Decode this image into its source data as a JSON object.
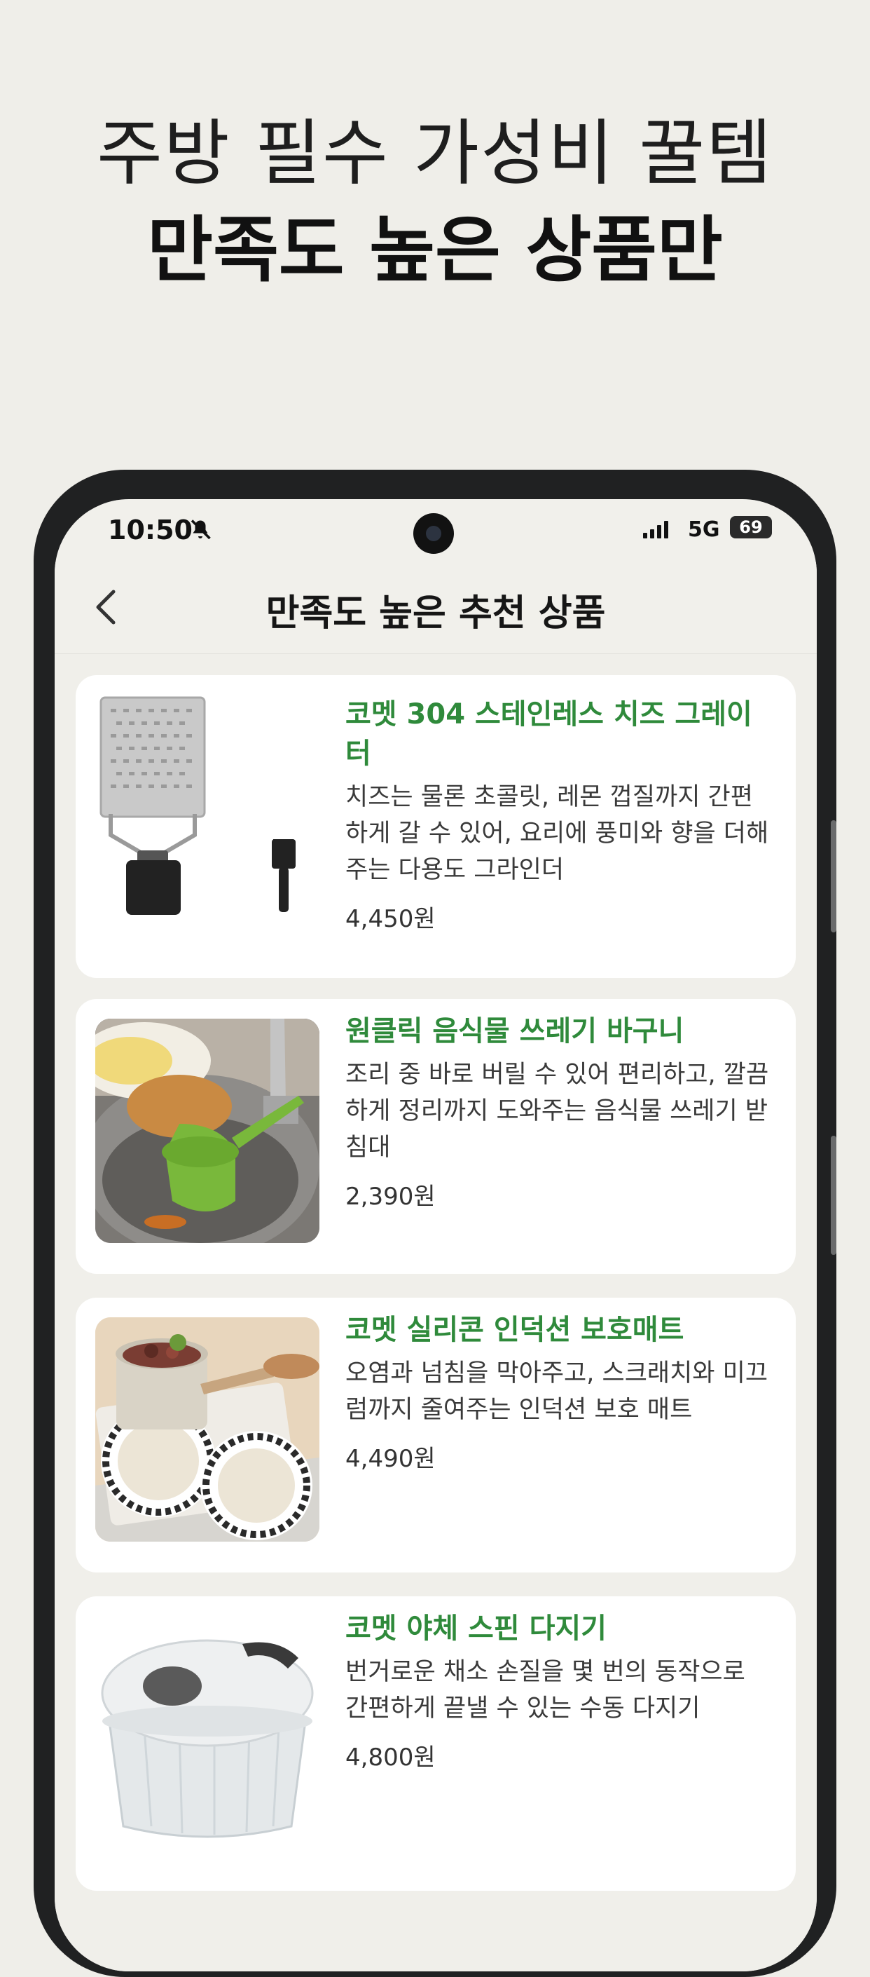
{
  "headline": {
    "line1": "주방 필수 가성비 꿀템",
    "line2": "만족도 높은 상품만"
  },
  "status_bar": {
    "time": "10:50",
    "network": "5G",
    "battery": "69"
  },
  "nav": {
    "title": "만족도 높은 추천 상품"
  },
  "products": [
    {
      "title": "코멧 304 스테인레스 치즈 그레이터",
      "description": "치즈는 물론 초콜릿, 레몬 껍질까지 간편하게 갈 수 있어, 요리에 풍미와 향을 더해주는 다용도 그라인더",
      "price": "4,450원"
    },
    {
      "title": "원클릭 음식물 쓰레기 바구니",
      "description": "조리 중 바로 버릴 수 있어 편리하고, 깔끔하게 정리까지 도와주는 음식물 쓰레기 받침대",
      "price": "2,390원"
    },
    {
      "title": "코멧 실리콘 인덕션 보호매트",
      "description": "오염과 넘침을 막아주고, 스크래치와 미끄럼까지 줄여주는 인덕션 보호 매트",
      "price": "4,490원"
    },
    {
      "title": "코멧 야체 스핀 다지기",
      "description": "번거로운 채소 손질을 몇 번의 동작으로 간편하게 끝낼 수 있는 수동 다지기",
      "price": "4,800원"
    }
  ],
  "colors": {
    "accent_green": "#2f8a3b",
    "page_bg": "#efeee9",
    "phone_frame": "#202122"
  }
}
